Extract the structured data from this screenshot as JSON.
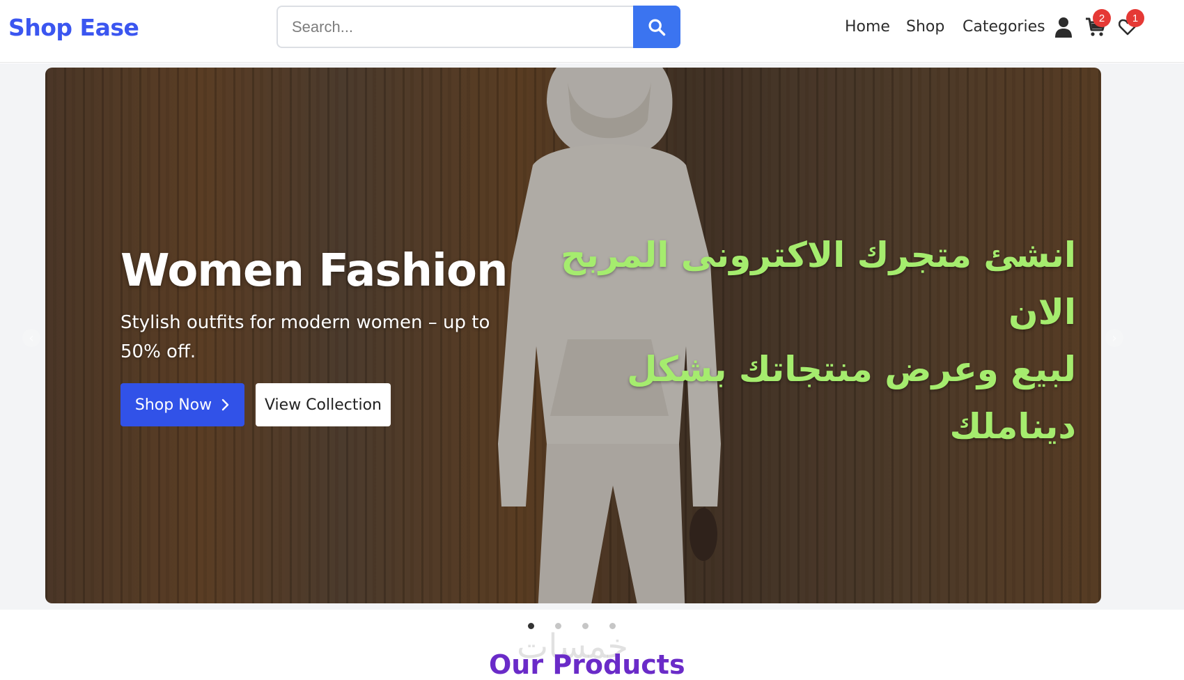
{
  "header": {
    "brand": "Shop Ease",
    "search": {
      "placeholder": "Search..."
    },
    "nav": {
      "home": "Home",
      "shop": "Shop",
      "categories": "Categories"
    },
    "cart_count": "2",
    "wishlist_count": "1"
  },
  "hero": {
    "title": "Women Fashion",
    "subtitle": "Stylish outfits for modern women – up to 50% off.",
    "shop_button": "Shop Now",
    "view_button": "View Collection",
    "arabic_line1": "انشئ متجرك الاكترونى المربح الان",
    "arabic_line2": "لبيع وعرض منتجاتك بشكل ديناملك",
    "prev_arrow": "‹",
    "next_arrow": "›",
    "slide_count": 4,
    "active_slide": 1
  },
  "watermark": "خمسات",
  "products": {
    "title": "Our Products"
  },
  "colors": {
    "brand": "#3b56f0",
    "primary_button": "#3152e8",
    "search_button": "#3b74f0",
    "arabic_text": "#a5ec6e",
    "section_title": "#6a2bc8",
    "badge": "#e53935"
  },
  "icons": [
    "search-icon",
    "user-icon",
    "cart-icon",
    "heart-icon",
    "chevron-right-icon"
  ]
}
